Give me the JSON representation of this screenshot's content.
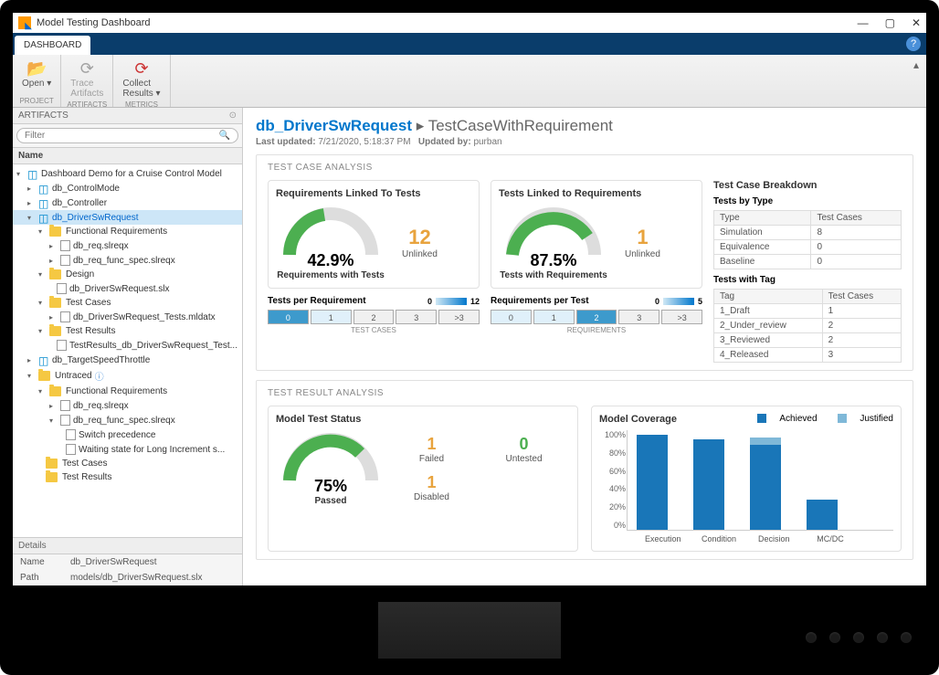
{
  "window": {
    "title": "Model Testing Dashboard"
  },
  "tab": {
    "label": "DASHBOARD"
  },
  "ribbon": {
    "open": "Open",
    "trace": "Trace\nArtifacts",
    "collect": "Collect\nResults",
    "g_project": "Project",
    "g_artifacts": "Artifacts",
    "g_metrics": "Metrics"
  },
  "sidebar": {
    "hdr": "ARTIFACTS",
    "filter_ph": "Filter",
    "name": "Name",
    "tree": {
      "root": "Dashboard Demo for a Cruise Control Model",
      "n0": "db_ControlMode",
      "n1": "db_Controller",
      "n2": "db_DriverSwRequest",
      "fr": "Functional Requirements",
      "fr1": "db_req.slreqx",
      "fr2": "db_req_func_spec.slreqx",
      "des": "Design",
      "des1": "db_DriverSwRequest.slx",
      "tc": "Test Cases",
      "tc1": "db_DriverSwRequest_Tests.mldatx",
      "tr": "Test Results",
      "tr1": "TestResults_db_DriverSwRequest_Test...",
      "n3": "db_TargetSpeedThrottle",
      "un": "Untraced",
      "ufr": "Functional Requirements",
      "ufr1": "db_req.slreqx",
      "ufr2": "db_req_func_spec.slreqx",
      "uf2a": "Switch precedence",
      "uf2b": "Waiting state for Long Increment s...",
      "utc": "Test Cases",
      "utr": "Test Results"
    },
    "details": {
      "hdr": "Details",
      "name_k": "Name",
      "name_v": "db_DriverSwRequest",
      "path_k": "Path",
      "path_v": "models/db_DriverSwRequest.slx"
    }
  },
  "crumb": {
    "a": "db_DriverSwRequest",
    "sep": "▸",
    "b": "TestCaseWithRequirement"
  },
  "meta": {
    "updated_l": "Last updated:",
    "updated_v": "7/21/2020, 5:18:37 PM",
    "by_l": "Updated by:",
    "by_v": "purban"
  },
  "sec1": {
    "title": "TEST CASE ANALYSIS",
    "c1": {
      "title": "Requirements Linked To Tests",
      "gval": "42.9%",
      "gsub": "Requirements with Tests",
      "num": "12",
      "sub": "Unlinked"
    },
    "c2": {
      "title": "Tests Linked to Requirements",
      "gval": "87.5%",
      "gsub": "Tests with Requirements",
      "num": "1",
      "sub": "Unlinked"
    },
    "h1": {
      "title": "Tests per Requirement",
      "max": "12",
      "cap": "TEST CASES",
      "labels": [
        "0",
        "1",
        "2",
        "3",
        ">3"
      ]
    },
    "h2": {
      "title": "Requirements per Test",
      "max": "5",
      "cap": "REQUIREMENTS",
      "labels": [
        "0",
        "1",
        "2",
        "3",
        ">3"
      ]
    },
    "bd": {
      "title": "Test Case Breakdown",
      "tt": "Tests by Type",
      "th1": "Type",
      "th2": "Test Cases",
      "rows": [
        [
          "Simulation",
          "8"
        ],
        [
          "Equivalence",
          "0"
        ],
        [
          "Baseline",
          "0"
        ]
      ],
      "tg": "Tests with Tag",
      "th3": "Tag",
      "tags": [
        [
          "1_Draft",
          "1"
        ],
        [
          "2_Under_review",
          "2"
        ],
        [
          "3_Reviewed",
          "2"
        ],
        [
          "4_Released",
          "3"
        ]
      ]
    }
  },
  "sec2": {
    "title": "TEST RESULT ANALYSIS",
    "st": {
      "title": "Model Test Status",
      "gval": "75%",
      "gsub": "Passed",
      "failed_n": "1",
      "failed_l": "Failed",
      "unt_n": "0",
      "unt_l": "Untested",
      "dis_n": "1",
      "dis_l": "Disabled"
    },
    "cov": {
      "title": "Model Coverage",
      "leg_a": "Achieved",
      "leg_j": "Justified"
    }
  },
  "chart_data": {
    "type": "bar",
    "title": "Model Coverage",
    "ylabel": "%",
    "ylim": [
      0,
      100
    ],
    "yticks": [
      0,
      20,
      40,
      60,
      80,
      100
    ],
    "categories": [
      "Execution",
      "Condition",
      "Decision",
      "MC/DC"
    ],
    "series": [
      {
        "name": "Achieved",
        "values": [
          95,
          90,
          85,
          30
        ],
        "color": "#1976b8"
      },
      {
        "name": "Justified",
        "values": [
          0,
          0,
          7,
          0
        ],
        "color": "#7fb8d8"
      }
    ]
  }
}
